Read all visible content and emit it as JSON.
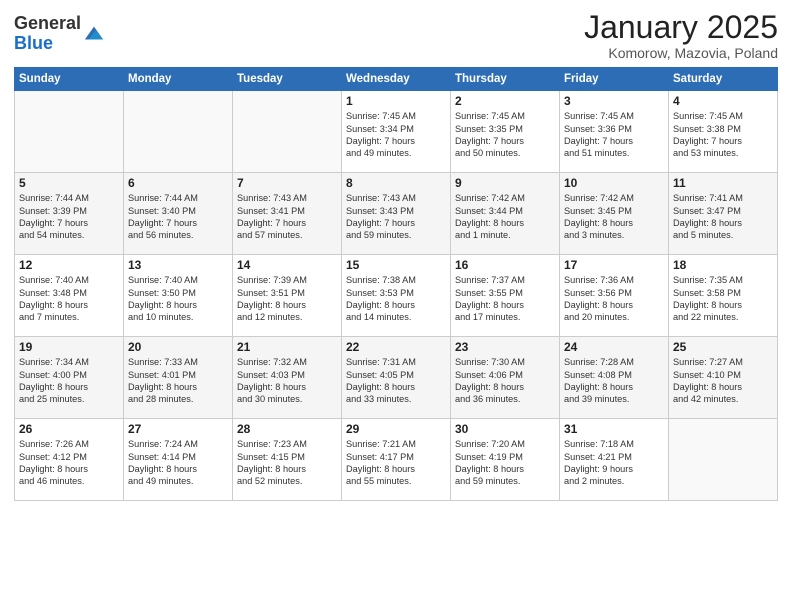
{
  "header": {
    "logo_general": "General",
    "logo_blue": "Blue",
    "month_title": "January 2025",
    "subtitle": "Komorow, Mazovia, Poland"
  },
  "weekdays": [
    "Sunday",
    "Monday",
    "Tuesday",
    "Wednesday",
    "Thursday",
    "Friday",
    "Saturday"
  ],
  "weeks": [
    [
      {
        "day": "",
        "info": ""
      },
      {
        "day": "",
        "info": ""
      },
      {
        "day": "",
        "info": ""
      },
      {
        "day": "1",
        "info": "Sunrise: 7:45 AM\nSunset: 3:34 PM\nDaylight: 7 hours\nand 49 minutes."
      },
      {
        "day": "2",
        "info": "Sunrise: 7:45 AM\nSunset: 3:35 PM\nDaylight: 7 hours\nand 50 minutes."
      },
      {
        "day": "3",
        "info": "Sunrise: 7:45 AM\nSunset: 3:36 PM\nDaylight: 7 hours\nand 51 minutes."
      },
      {
        "day": "4",
        "info": "Sunrise: 7:45 AM\nSunset: 3:38 PM\nDaylight: 7 hours\nand 53 minutes."
      }
    ],
    [
      {
        "day": "5",
        "info": "Sunrise: 7:44 AM\nSunset: 3:39 PM\nDaylight: 7 hours\nand 54 minutes."
      },
      {
        "day": "6",
        "info": "Sunrise: 7:44 AM\nSunset: 3:40 PM\nDaylight: 7 hours\nand 56 minutes."
      },
      {
        "day": "7",
        "info": "Sunrise: 7:43 AM\nSunset: 3:41 PM\nDaylight: 7 hours\nand 57 minutes."
      },
      {
        "day": "8",
        "info": "Sunrise: 7:43 AM\nSunset: 3:43 PM\nDaylight: 7 hours\nand 59 minutes."
      },
      {
        "day": "9",
        "info": "Sunrise: 7:42 AM\nSunset: 3:44 PM\nDaylight: 8 hours\nand 1 minute."
      },
      {
        "day": "10",
        "info": "Sunrise: 7:42 AM\nSunset: 3:45 PM\nDaylight: 8 hours\nand 3 minutes."
      },
      {
        "day": "11",
        "info": "Sunrise: 7:41 AM\nSunset: 3:47 PM\nDaylight: 8 hours\nand 5 minutes."
      }
    ],
    [
      {
        "day": "12",
        "info": "Sunrise: 7:40 AM\nSunset: 3:48 PM\nDaylight: 8 hours\nand 7 minutes."
      },
      {
        "day": "13",
        "info": "Sunrise: 7:40 AM\nSunset: 3:50 PM\nDaylight: 8 hours\nand 10 minutes."
      },
      {
        "day": "14",
        "info": "Sunrise: 7:39 AM\nSunset: 3:51 PM\nDaylight: 8 hours\nand 12 minutes."
      },
      {
        "day": "15",
        "info": "Sunrise: 7:38 AM\nSunset: 3:53 PM\nDaylight: 8 hours\nand 14 minutes."
      },
      {
        "day": "16",
        "info": "Sunrise: 7:37 AM\nSunset: 3:55 PM\nDaylight: 8 hours\nand 17 minutes."
      },
      {
        "day": "17",
        "info": "Sunrise: 7:36 AM\nSunset: 3:56 PM\nDaylight: 8 hours\nand 20 minutes."
      },
      {
        "day": "18",
        "info": "Sunrise: 7:35 AM\nSunset: 3:58 PM\nDaylight: 8 hours\nand 22 minutes."
      }
    ],
    [
      {
        "day": "19",
        "info": "Sunrise: 7:34 AM\nSunset: 4:00 PM\nDaylight: 8 hours\nand 25 minutes."
      },
      {
        "day": "20",
        "info": "Sunrise: 7:33 AM\nSunset: 4:01 PM\nDaylight: 8 hours\nand 28 minutes."
      },
      {
        "day": "21",
        "info": "Sunrise: 7:32 AM\nSunset: 4:03 PM\nDaylight: 8 hours\nand 30 minutes."
      },
      {
        "day": "22",
        "info": "Sunrise: 7:31 AM\nSunset: 4:05 PM\nDaylight: 8 hours\nand 33 minutes."
      },
      {
        "day": "23",
        "info": "Sunrise: 7:30 AM\nSunset: 4:06 PM\nDaylight: 8 hours\nand 36 minutes."
      },
      {
        "day": "24",
        "info": "Sunrise: 7:28 AM\nSunset: 4:08 PM\nDaylight: 8 hours\nand 39 minutes."
      },
      {
        "day": "25",
        "info": "Sunrise: 7:27 AM\nSunset: 4:10 PM\nDaylight: 8 hours\nand 42 minutes."
      }
    ],
    [
      {
        "day": "26",
        "info": "Sunrise: 7:26 AM\nSunset: 4:12 PM\nDaylight: 8 hours\nand 46 minutes."
      },
      {
        "day": "27",
        "info": "Sunrise: 7:24 AM\nSunset: 4:14 PM\nDaylight: 8 hours\nand 49 minutes."
      },
      {
        "day": "28",
        "info": "Sunrise: 7:23 AM\nSunset: 4:15 PM\nDaylight: 8 hours\nand 52 minutes."
      },
      {
        "day": "29",
        "info": "Sunrise: 7:21 AM\nSunset: 4:17 PM\nDaylight: 8 hours\nand 55 minutes."
      },
      {
        "day": "30",
        "info": "Sunrise: 7:20 AM\nSunset: 4:19 PM\nDaylight: 8 hours\nand 59 minutes."
      },
      {
        "day": "31",
        "info": "Sunrise: 7:18 AM\nSunset: 4:21 PM\nDaylight: 9 hours\nand 2 minutes."
      },
      {
        "day": "",
        "info": ""
      }
    ]
  ]
}
